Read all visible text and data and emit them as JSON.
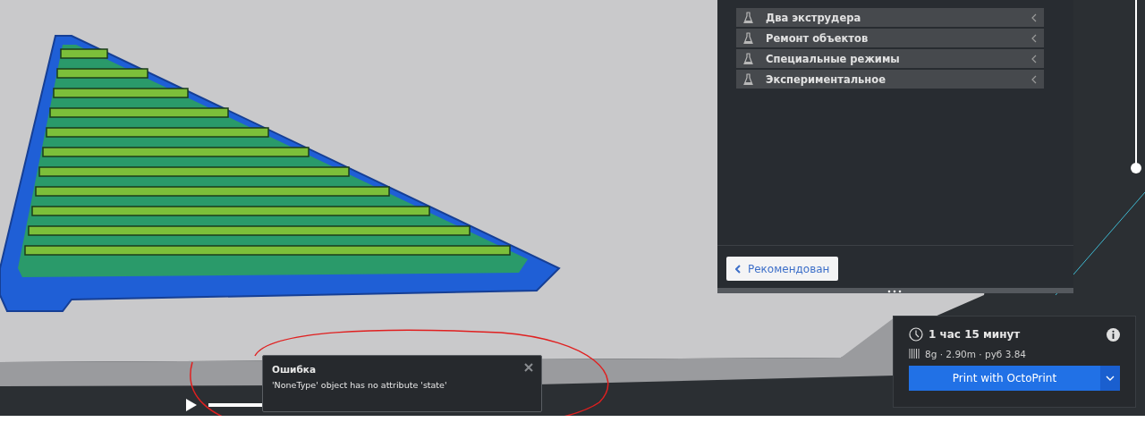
{
  "settings_panel": {
    "categories": [
      {
        "label": "Два экструдера"
      },
      {
        "label": "Ремонт объектов"
      },
      {
        "label": "Специальные режимы"
      },
      {
        "label": "Экспериментальное"
      }
    ],
    "recommended_button": "Рекомендован"
  },
  "print_panel": {
    "time": "1 час 15 минут",
    "material": "8g · 2.90m · руб 3.84",
    "print_button": "Print with OctoPrint"
  },
  "layer_slider": {
    "level": 1
  },
  "simulation_slider": {
    "level": 1
  },
  "error_message": {
    "title": "Ошибка",
    "text": "'NoneType' object has no attribute 'state'"
  }
}
